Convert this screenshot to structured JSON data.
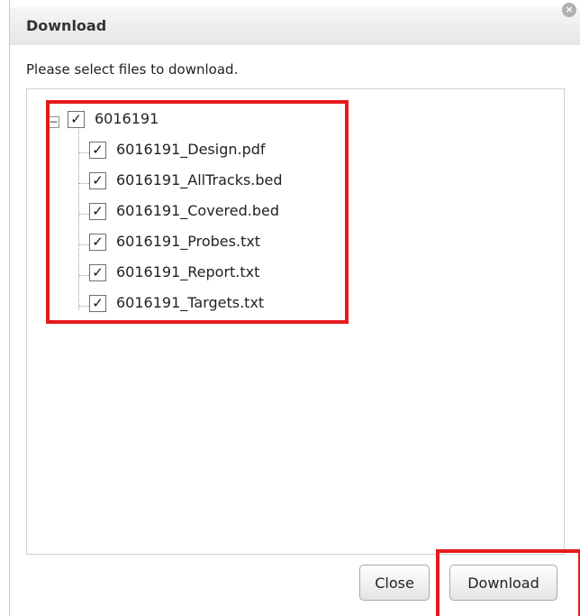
{
  "dialog": {
    "title": "Download",
    "close_icon": "close-circle-icon",
    "prompt": "Please select files to download."
  },
  "tree": {
    "root": {
      "label": "6016191",
      "expanded": true,
      "expander_symbol": "−",
      "checked": true
    },
    "files": [
      {
        "label": "6016191_Design.pdf",
        "checked": true
      },
      {
        "label": "6016191_AllTracks.bed",
        "checked": true
      },
      {
        "label": "6016191_Covered.bed",
        "checked": true
      },
      {
        "label": "6016191_Probes.txt",
        "checked": true
      },
      {
        "label": "6016191_Report.txt",
        "checked": true
      },
      {
        "label": "6016191_Targets.txt",
        "checked": true
      }
    ],
    "check_mark": "✓"
  },
  "buttons": {
    "close_label": "Close",
    "download_label": "Download"
  },
  "colors": {
    "highlight": "#e41a1a",
    "titlebar": "#ececec"
  }
}
